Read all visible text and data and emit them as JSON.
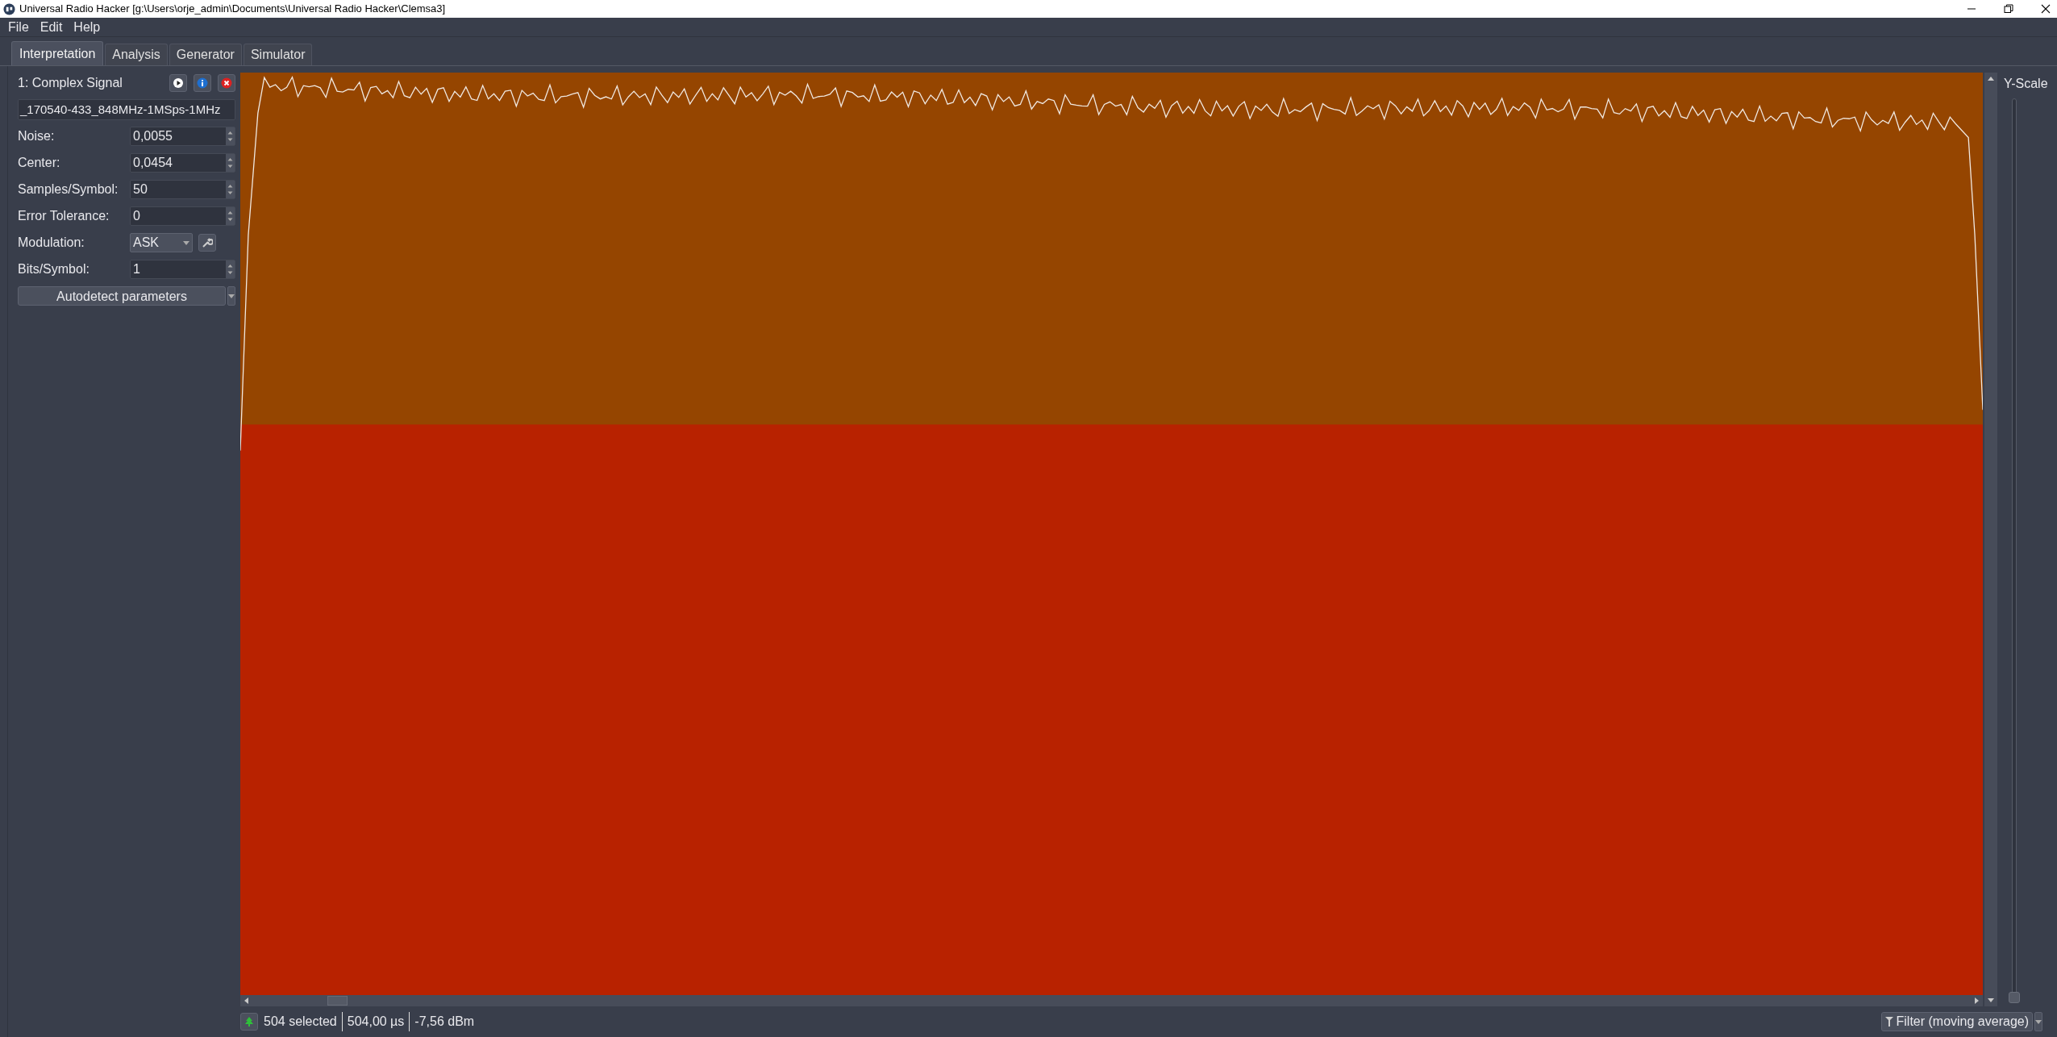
{
  "window": {
    "title": "Universal Radio Hacker [g:\\Users\\orje_admin\\Documents\\Universal Radio Hacker\\Clemsa3]"
  },
  "menu": [
    "File",
    "Edit",
    "Help"
  ],
  "tabs": [
    {
      "label": "Interpretation",
      "selected": true
    },
    {
      "label": "Analysis",
      "selected": false
    },
    {
      "label": "Generator",
      "selected": false
    },
    {
      "label": "Simulator",
      "selected": false
    }
  ],
  "signal": {
    "name": "1: Complex Signal",
    "filename": "_170540-433_848MHz-1MSps-1MHz"
  },
  "parameters": [
    {
      "kind": "spin",
      "label": "Noise:",
      "value": "0,0055"
    },
    {
      "kind": "spin",
      "label": "Center:",
      "value": "0,0454"
    },
    {
      "kind": "spin",
      "label": "Samples/Symbol:",
      "value": "50"
    },
    {
      "kind": "spin",
      "label": "Error Tolerance:",
      "value": "0"
    },
    {
      "kind": "combo",
      "label": "Modulation:",
      "value": "ASK"
    },
    {
      "kind": "spin",
      "label": "Bits/Symbol:",
      "value": "1"
    }
  ],
  "autodetect_button": "Autodetect parameters",
  "y_scale": {
    "label": "Y-Scale",
    "level": 0
  },
  "status": {
    "selected": "504 selected",
    "duration": "504,00 µs",
    "power": "-7,56 dBm"
  },
  "filter_button": "Filter (moving average)"
}
